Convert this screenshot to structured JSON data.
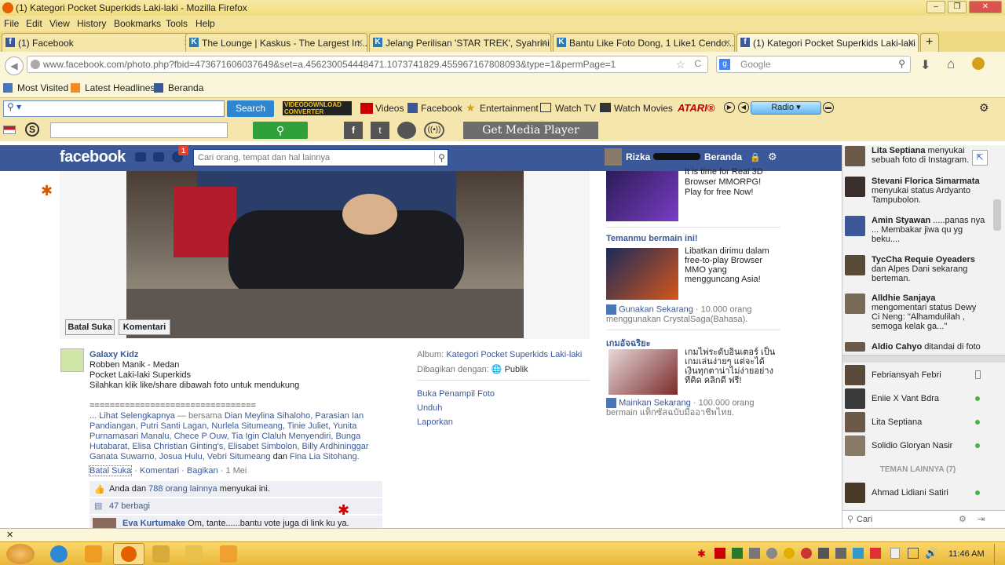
{
  "window": {
    "title": "(1) Kategori Pocket Superkids Laki-laki - Mozilla Firefox"
  },
  "menu": [
    "File",
    "Edit",
    "View",
    "History",
    "Bookmarks",
    "Tools",
    "Help"
  ],
  "tabs": [
    {
      "label": "(1) Facebook"
    },
    {
      "label": "The Lounge | Kaskus - The Largest In..."
    },
    {
      "label": "Jelang Perilisan 'STAR TREK', Syahrini ..."
    },
    {
      "label": "Bantu Like Foto Dong, 1 Like1 Cendo..."
    },
    {
      "label": "(1) Kategori Pocket Superkids Laki-laki"
    }
  ],
  "address": {
    "url_domain": "www.facebook.com",
    "url_rest": "/photo.php?fbid=473671606037649&set=a.456230054448471.1073741829.455967167808093&type=1&permPage=1",
    "search_placeholder": "Google"
  },
  "bookmarks": [
    "Most Visited",
    "Latest Headlines",
    "Beranda"
  ],
  "toolbar1": {
    "search_btn": "Search",
    "converter": "VIDEODOWNLOAD CONVERTER",
    "videos": "Videos",
    "facebook": "Facebook",
    "entertainment": "Entertainment",
    "watch_tv": "Watch TV",
    "watch_movies": "Watch Movies",
    "atari": "ATARI®",
    "radio": "Radio"
  },
  "toolbar2": {
    "plugin": "Get Media Player Plugin"
  },
  "fb": {
    "logo": "facebook",
    "notif_count": "1",
    "search_placeholder": "Cari orang, tempat dan hal lainnya",
    "user_name": "Rizka",
    "home": "Beranda",
    "photo_actions": {
      "unlike": "Batal Suka",
      "comment": "Komentari"
    },
    "post": {
      "author": "Galaxy Kidz",
      "line1": "Robben Manik - Medan",
      "line2": "Pocket Laki-laki Superkids",
      "line3": "Silahkan klik like/share dibawah foto untuk mendukung",
      "separator": "=================================",
      "see_more": "... Lihat Selengkapnya",
      "with": "— bersama",
      "tagged": "Dian Meylina Sihaloho, Parasian Ian Pandiangan, Putri Santi Lagan, Nurlela Situmeang, Tinie Juliet, Yunita Purnamasari Manalu, Chece P Ouw, Tia Igin Claluh Menyendiri, Bunga Hutabarat, Elisa Christian Ginting's, Elisabet Simbolon, Billy Ardhininggar Ganata Suwarno, Josua Hulu, Vebri Situmeang",
      "and": "dan",
      "last_tag": "Fina Lia Sitohang.",
      "action_unlike": "Batal Suka",
      "action_comment": "Komentari",
      "action_share": "Bagikan",
      "date": "1 Mei",
      "likes_prefix": "Anda dan",
      "likes_link": "788 orang lainnya",
      "likes_suffix": "menyukai ini.",
      "shares": "47 berbagi",
      "comment_author": "Eva Kurtumake",
      "comment_text": "Om, tante......bantu vote juga di link ku ya."
    },
    "meta": {
      "album_label": "Album:",
      "album_value": "Kategori Pocket Superkids Laki-laki",
      "shared_label": "Dibagikan dengan:",
      "shared_value": "Publik",
      "open_viewer": "Buka Penampil Foto",
      "download": "Unduh",
      "report": "Laporkan"
    },
    "ads": [
      {
        "text": "It is time for Real 3D Browser MMORPG! Play for free Now!"
      },
      {
        "heading": "Temanmu bermain ini!",
        "text": "Libatkan dirimu dalam free-to-play Browser MMO yang mengguncang Asia!",
        "action": "Gunakan Sekarang",
        "stat": " · 10.000 orang menggunakan CrystalSaga(Bahasa)."
      },
      {
        "heading": "เกมอัจฉริยะ",
        "text": "เกมไพ่ระดับอินเตอร์ เป็นเกมเล่นง่ายๆ แต่จะได้เงินทุกตาน่าไม่ง่ายอย่างที่คิด คลิกดี ฟรี!",
        "action": "Mainkan Sekarang",
        "stat": " · 100.000 orang bermain แท็กซัสฉบับมืออาชีพไทย."
      }
    ]
  },
  "ticker": [
    {
      "name": "Lita Septiana",
      "text": "menyukai sebuah foto di Instagram."
    },
    {
      "name": "Stevani Florica Simarmata",
      "text": "menyukai status Ardyanto Tampubolon."
    },
    {
      "name": "Amin Styawan",
      "text": ".....panas nya ... Membakar jiwa qu yg beku...."
    },
    {
      "name": "TycCha Requie Oyeaders",
      "text": "dan Alpes Dani sekarang berteman."
    },
    {
      "name": "Alldhie Sanjaya",
      "text": "mengomentari status Dewy Ci Neng: \"Alhamdulilah , semoga kelak ga...\""
    },
    {
      "name": "Aldio Cahyo",
      "text": "ditandai di foto"
    }
  ],
  "chat": {
    "friends": [
      "Febriansyah Febri",
      "Eniie X Vant Bdra",
      "Lita Septiana",
      "Solidio Gloryan Nasir"
    ],
    "others_label": "TEMAN LAINNYA (7)",
    "others": [
      "Ahmad Lidiani Satiri"
    ],
    "search_placeholder": "Cari"
  },
  "taskbar": {
    "time": "11:46 AM"
  }
}
